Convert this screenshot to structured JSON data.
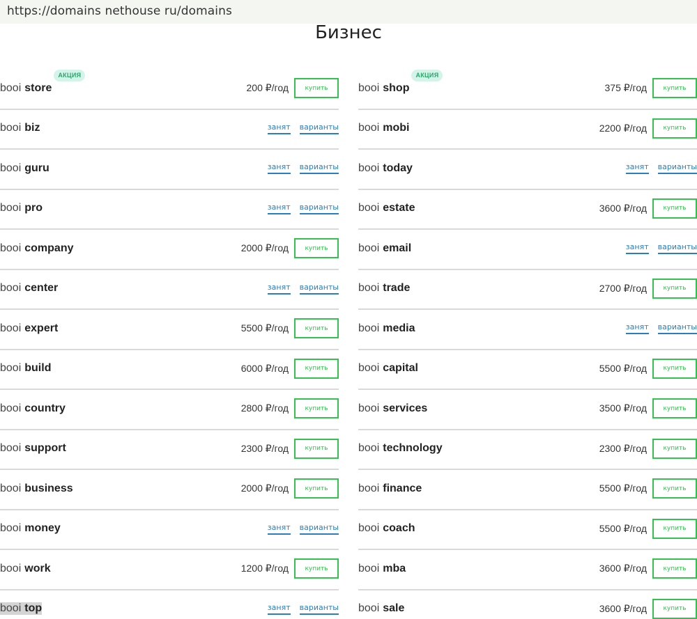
{
  "url": "https://domains nethouse ru/domains",
  "title": "Бизнес",
  "labels": {
    "taken": "занят",
    "variants": "варианты",
    "buy": "купить",
    "promo": "АКЦИЯ"
  },
  "columns": [
    [
      {
        "name": "booi",
        "zone": "store",
        "price": "200 ₽/год",
        "available": true,
        "promo": true
      },
      {
        "name": "booi",
        "zone": "biz",
        "available": false
      },
      {
        "name": "booi",
        "zone": "guru",
        "available": false
      },
      {
        "name": "booi",
        "zone": "pro",
        "available": false
      },
      {
        "name": "booi",
        "zone": "company",
        "price": "2000 ₽/год",
        "available": true
      },
      {
        "name": "booi",
        "zone": "center",
        "available": false
      },
      {
        "name": "booi",
        "zone": "expert",
        "price": "5500 ₽/год",
        "available": true
      },
      {
        "name": "booi",
        "zone": "build",
        "price": "6000 ₽/год",
        "available": true
      },
      {
        "name": "booi",
        "zone": "country",
        "price": "2800 ₽/год",
        "available": true
      },
      {
        "name": "booi",
        "zone": "support",
        "price": "2300 ₽/год",
        "available": true
      },
      {
        "name": "booi",
        "zone": "business",
        "price": "2000 ₽/год",
        "available": true
      },
      {
        "name": "booi",
        "zone": "money",
        "available": false
      },
      {
        "name": "booi",
        "zone": "work",
        "price": "1200 ₽/год",
        "available": true
      },
      {
        "name": "booi",
        "zone": "top",
        "available": false,
        "selected": true
      }
    ],
    [
      {
        "name": "booi",
        "zone": "shop",
        "price": "375 ₽/год",
        "available": true,
        "promo": true
      },
      {
        "name": "booi",
        "zone": "mobi",
        "price": "2200 ₽/год",
        "available": true
      },
      {
        "name": "booi",
        "zone": "today",
        "available": false
      },
      {
        "name": "booi",
        "zone": "estate",
        "price": "3600 ₽/год",
        "available": true
      },
      {
        "name": "booi",
        "zone": "email",
        "available": false
      },
      {
        "name": "booi",
        "zone": "trade",
        "price": "2700 ₽/год",
        "available": true
      },
      {
        "name": "booi",
        "zone": "media",
        "available": false
      },
      {
        "name": "booi",
        "zone": "capital",
        "price": "5500 ₽/год",
        "available": true
      },
      {
        "name": "booi",
        "zone": "services",
        "price": "3500 ₽/год",
        "available": true
      },
      {
        "name": "booi",
        "zone": "technology",
        "price": "2300 ₽/год",
        "available": true
      },
      {
        "name": "booi",
        "zone": "finance",
        "price": "5500 ₽/год",
        "available": true
      },
      {
        "name": "booi",
        "zone": "coach",
        "price": "5500 ₽/год",
        "available": true
      },
      {
        "name": "booi",
        "zone": "mba",
        "price": "3600 ₽/год",
        "available": true
      },
      {
        "name": "booi",
        "zone": "sale",
        "price": "3600 ₽/год",
        "available": true
      }
    ]
  ]
}
